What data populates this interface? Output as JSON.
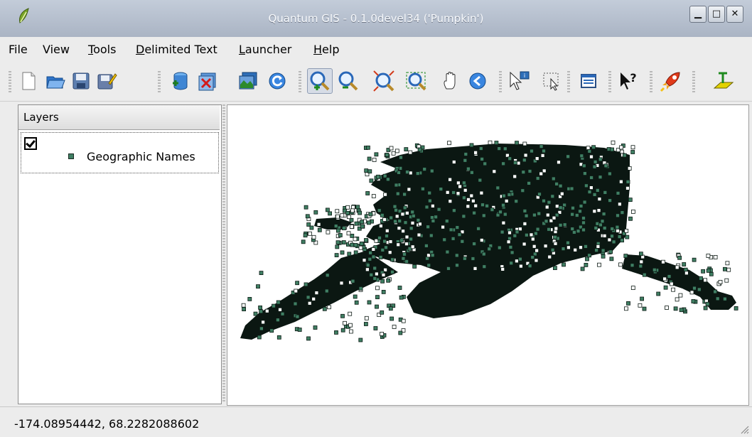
{
  "window": {
    "title": "Quantum GIS - 0.1.0devel34 ('Pumpkin')",
    "buttons": [
      {
        "icon": "minimize-icon",
        "glyph": "▁"
      },
      {
        "icon": "maximize-icon",
        "glyph": "□"
      },
      {
        "icon": "close-icon",
        "glyph": "✕"
      }
    ]
  },
  "menu": {
    "items": [
      {
        "label": "File"
      },
      {
        "label": "View"
      },
      {
        "label": "Tools"
      },
      {
        "label": "Delimited Text"
      },
      {
        "label": "Launcher"
      },
      {
        "label": "Help"
      }
    ]
  },
  "toolbar": {
    "buttons": [
      {
        "icon": "new-project-icon"
      },
      {
        "icon": "open-project-icon"
      },
      {
        "icon": "save-project-icon"
      },
      {
        "icon": "save-project-as-icon"
      },
      {
        "icon": "add-vector-layer-icon"
      },
      {
        "icon": "remove-layer-icon"
      },
      {
        "icon": "add-raster-layer-icon"
      },
      {
        "icon": "refresh-icon"
      },
      {
        "icon": "zoom-in-icon",
        "active": true
      },
      {
        "icon": "zoom-out-icon"
      },
      {
        "icon": "zoom-full-extent-icon"
      },
      {
        "icon": "zoom-to-layer-icon"
      },
      {
        "icon": "pan-icon"
      },
      {
        "icon": "zoom-previous-icon"
      },
      {
        "icon": "identify-icon"
      },
      {
        "icon": "select-features-icon"
      },
      {
        "icon": "attribute-table-icon"
      },
      {
        "icon": "whats-this-icon"
      },
      {
        "icon": "launcher-icon"
      },
      {
        "icon": "delimited-text-plugin-icon"
      }
    ]
  },
  "layers": {
    "header": "Layers",
    "items": [
      {
        "name": "Geographic Names",
        "visible": true,
        "color": "#3f7f63"
      }
    ]
  },
  "map": {
    "background": "#ffffff",
    "point_fill": "#3f7f63",
    "point_stroke": "#0d1a14"
  },
  "status": {
    "coordinates": "-174.08954442, 68.2282088602"
  }
}
